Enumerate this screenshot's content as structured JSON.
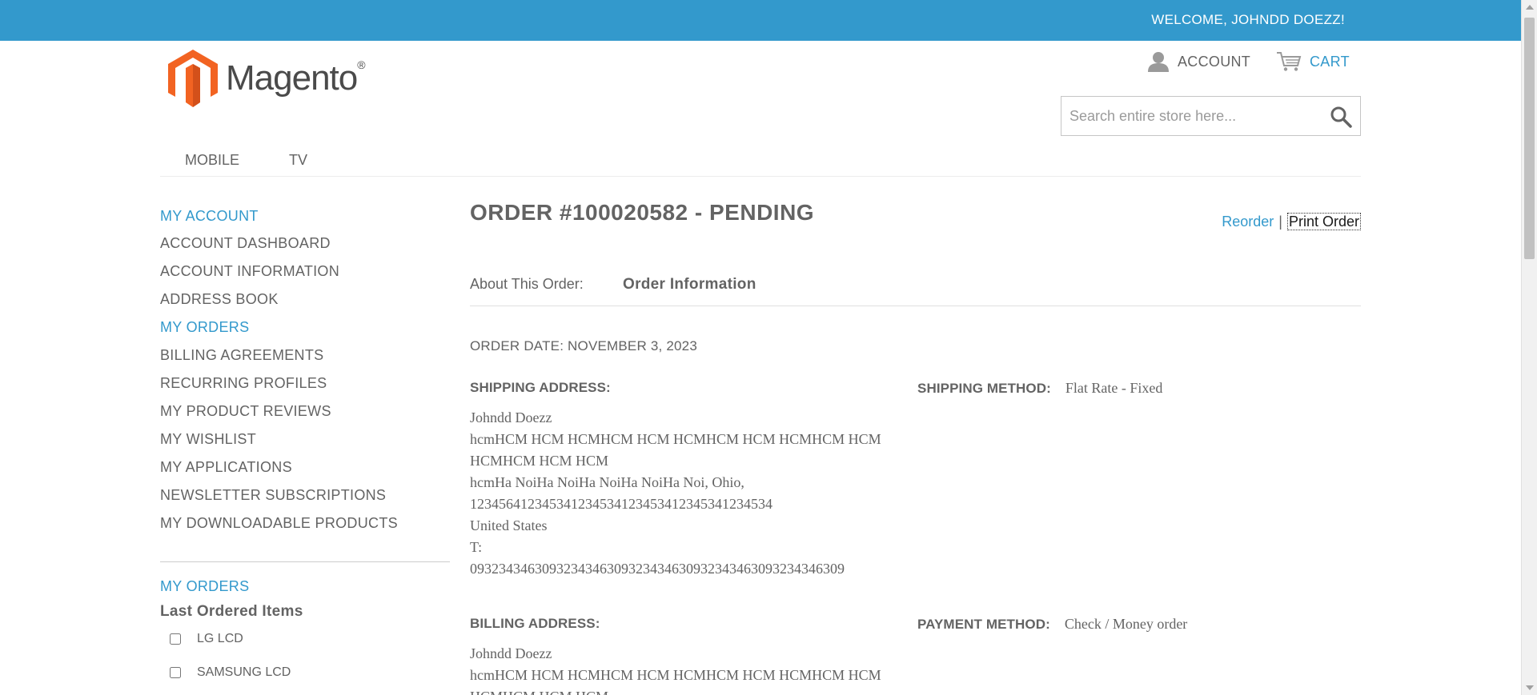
{
  "header": {
    "welcome": "WELCOME, JOHNDD DOEZZ!",
    "logo_text": "Magento",
    "logo_reg": "®",
    "account_label": "ACCOUNT",
    "cart_label": "CART",
    "search_placeholder": "Search entire store here...",
    "accent_color": "#3399cc"
  },
  "nav": {
    "items": [
      {
        "label": "MOBILE"
      },
      {
        "label": "TV"
      }
    ]
  },
  "sidebar": {
    "title": "MY ACCOUNT",
    "items": [
      {
        "label": "ACCOUNT DASHBOARD"
      },
      {
        "label": "ACCOUNT INFORMATION"
      },
      {
        "label": "ADDRESS BOOK"
      },
      {
        "label": "MY ORDERS"
      },
      {
        "label": "BILLING AGREEMENTS"
      },
      {
        "label": "RECURRING PROFILES"
      },
      {
        "label": "MY PRODUCT REVIEWS"
      },
      {
        "label": "MY WISHLIST"
      },
      {
        "label": "MY APPLICATIONS"
      },
      {
        "label": "NEWSLETTER SUBSCRIPTIONS"
      },
      {
        "label": "MY DOWNLOADABLE PRODUCTS"
      }
    ],
    "orders_title": "MY ORDERS",
    "last_ordered_title": "Last Ordered Items",
    "last_ordered_items": [
      {
        "label": "LG LCD"
      },
      {
        "label": "SAMSUNG LCD"
      }
    ]
  },
  "order": {
    "title": "ORDER #100020582 - PENDING",
    "reorder_label": "Reorder",
    "separator": "|",
    "print_label": "Print Order",
    "about_label": "About This Order:",
    "info_tab_label": "Order Information",
    "order_date": "ORDER DATE: NOVEMBER 3, 2023",
    "shipping_address": {
      "label": "SHIPPING ADDRESS:",
      "lines": [
        "Johndd Doezz",
        "hcmHCM HCM HCMHCM HCM HCMHCM HCM HCMHCM HCM",
        "HCMHCM HCM HCM",
        "hcmHa NoiHa NoiHa NoiHa NoiHa Noi, Ohio,",
        "123456412345341234534123453412345341234534",
        "United States",
        "T:",
        "0932343463093234346309323434630932343463093234346309"
      ]
    },
    "shipping_method": {
      "label": "SHIPPING METHOD:",
      "value": "Flat Rate - Fixed"
    },
    "billing_address": {
      "label": "BILLING ADDRESS:",
      "lines": [
        "Johndd Doezz",
        "hcmHCM HCM HCMHCM HCM HCMHCM HCM HCMHCM HCM",
        "HCMHCM HCM HCM"
      ]
    },
    "payment_method": {
      "label": "PAYMENT METHOD:",
      "value": "Check / Money order"
    }
  }
}
